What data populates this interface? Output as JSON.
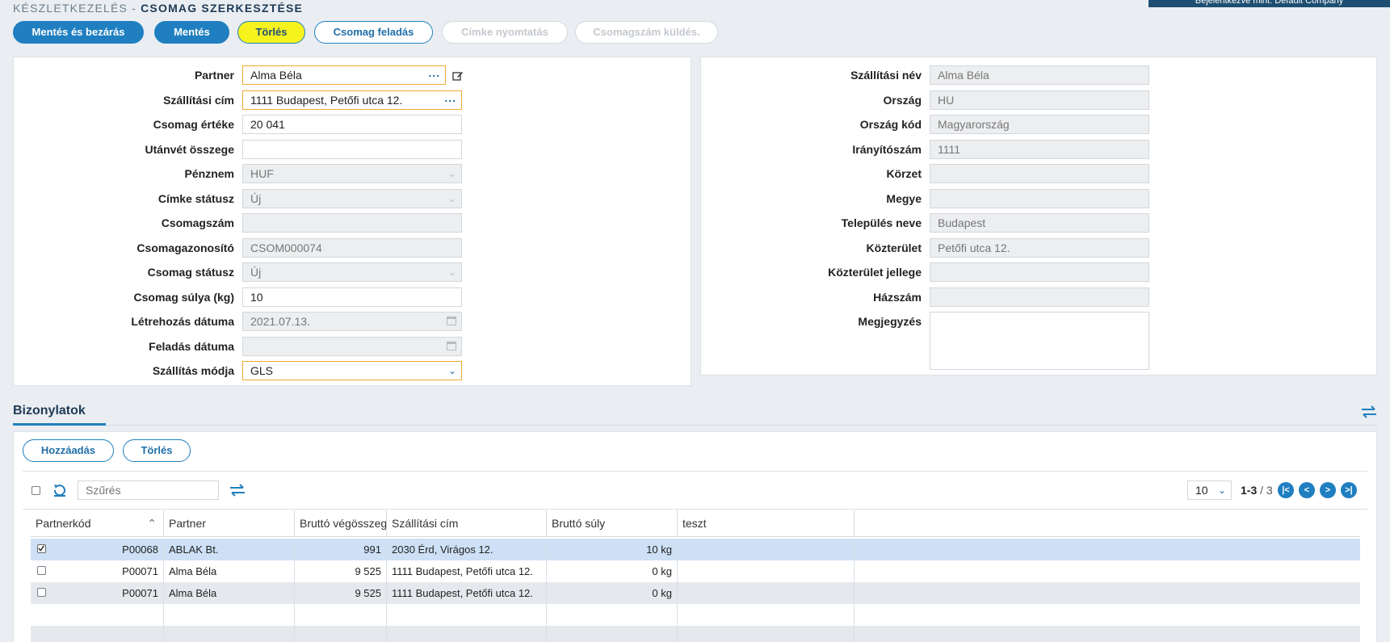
{
  "breadcrumb": {
    "parent": "KÉSZLETKEZELÉS -",
    "current": "CSOMAG SZERKESZTÉSE"
  },
  "user": {
    "text": "Bejelentkezve mint: Default Company"
  },
  "toolbar": {
    "save_close": "Mentés és bezárás",
    "save": "Mentés",
    "delete": "Törlés",
    "send_package": "Csomag feladás",
    "print_label": "Címke nyomtatás",
    "send_number": "Csomagszám küldés."
  },
  "left_form": {
    "partner": {
      "label": "Partner",
      "value": "Alma Béla"
    },
    "address": {
      "label": "Szállítási cím",
      "value": "1111 Budapest, Petőfi utca 12."
    },
    "value": {
      "label": "Csomag értéke",
      "value": "20 041"
    },
    "cod": {
      "label": "Utánvét összege",
      "value": ""
    },
    "currency": {
      "label": "Pénznem",
      "value": "HUF"
    },
    "label_status": {
      "label": "Címke státusz",
      "value": "Új"
    },
    "package_no": {
      "label": "Csomagszám",
      "value": ""
    },
    "package_id": {
      "label": "Csomagazonosító",
      "value": "CSOM000074"
    },
    "package_status": {
      "label": "Csomag státusz",
      "value": "Új"
    },
    "weight": {
      "label": "Csomag súlya (kg)",
      "value": "10"
    },
    "created": {
      "label": "Létrehozás dátuma",
      "value": "2021.07.13."
    },
    "sent": {
      "label": "Feladás dátuma",
      "value": ""
    },
    "shipping": {
      "label": "Szállítás módja",
      "value": "GLS"
    }
  },
  "right_form": {
    "name": {
      "label": "Szállítási név",
      "value": "Alma Béla"
    },
    "country": {
      "label": "Ország",
      "value": "HU"
    },
    "country_code": {
      "label": "Ország kód",
      "value": "Magyarország"
    },
    "zip": {
      "label": "Irányítószám",
      "value": "1111"
    },
    "district": {
      "label": "Körzet",
      "value": ""
    },
    "county": {
      "label": "Megye",
      "value": ""
    },
    "city": {
      "label": "Település neve",
      "value": "Budapest"
    },
    "street": {
      "label": "Közterület",
      "value": "Petőfi utca 12."
    },
    "street_type": {
      "label": "Közterület jellege",
      "value": ""
    },
    "house": {
      "label": "Házszám",
      "value": ""
    },
    "note": {
      "label": "Megjegyzés",
      "value": ""
    }
  },
  "docs": {
    "tab": "Bizonylatok",
    "add": "Hozzáadás",
    "delete": "Törlés",
    "filter_placeholder": "Szűrés",
    "page_size": "10",
    "range": "1-3",
    "total": "/ 3",
    "columns": [
      "Partnerkód",
      "Partner",
      "Bruttó végösszeg",
      "Szállítási cím",
      "Bruttó súly",
      "teszt"
    ],
    "rows": [
      {
        "code": "P00068",
        "partner": "ABLAK Bt.",
        "total": "991",
        "address": "2030 Érd, Virágos 12.",
        "weight": "10 kg",
        "teszt": "",
        "checked": true
      },
      {
        "code": "P00071",
        "partner": "Alma Béla",
        "total": "9 525",
        "address": "1111 Budapest, Petőfi utca 12.",
        "weight": "0 kg",
        "teszt": "",
        "checked": false
      },
      {
        "code": "P00071",
        "partner": "Alma Béla",
        "total": "9 525",
        "address": "1111 Budapest, Petőfi utca 12.",
        "weight": "0 kg",
        "teszt": "",
        "checked": false
      }
    ]
  },
  "colors": {
    "accent": "#1f7fc0",
    "highlight": "#f6f21c",
    "selected_row": "#cde0f5",
    "field_border_active": "#f0a830"
  },
  "icons": [
    "edit-icon",
    "calendar-icon",
    "chevron-down-icon",
    "refresh-icon",
    "swap-icon",
    "first-page-icon",
    "prev-page-icon",
    "next-page-icon",
    "last-page-icon"
  ]
}
